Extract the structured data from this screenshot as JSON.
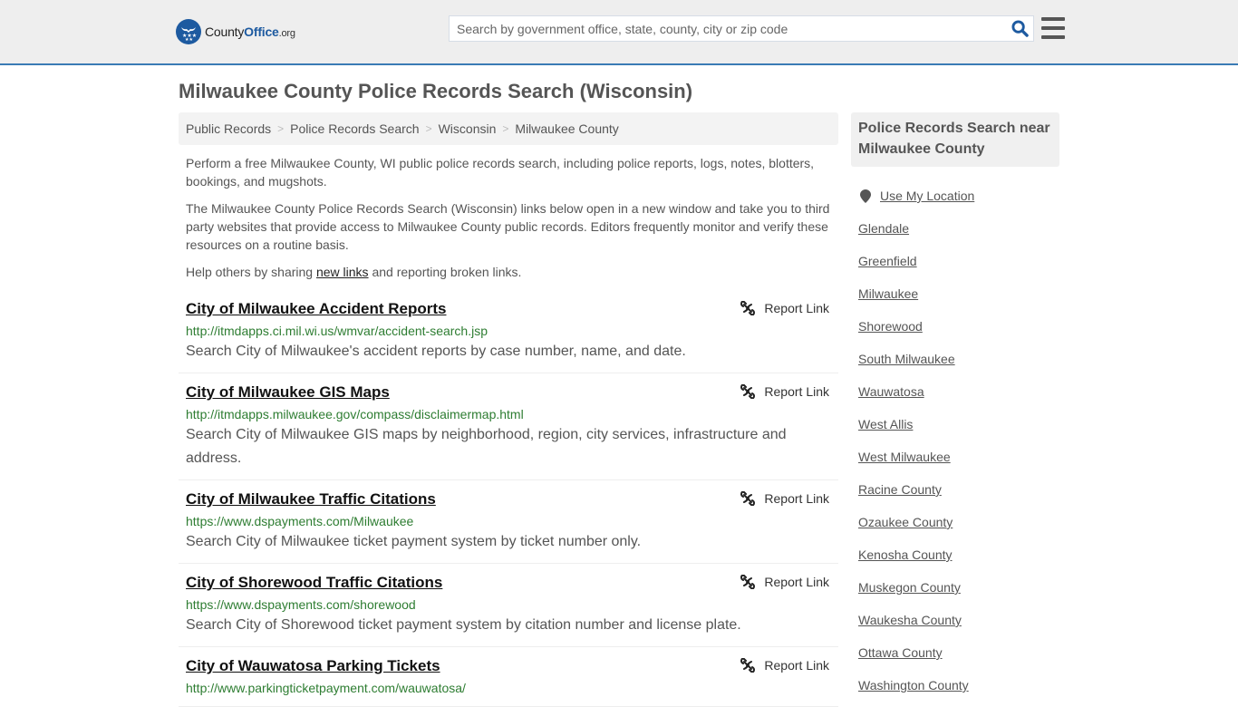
{
  "header": {
    "logo": {
      "brand_prefix": "County",
      "brand_main": "Office",
      "brand_suffix": ".org",
      "icon": "eagle-stars-logo-icon"
    },
    "search": {
      "placeholder": "Search by government office, state, county, city or zip code",
      "value": "",
      "icon": "search-icon"
    },
    "menu_icon": "hamburger-menu-icon"
  },
  "page": {
    "title": "Milwaukee County Police Records Search (Wisconsin)"
  },
  "breadcrumb": [
    {
      "label": "Public Records"
    },
    {
      "label": "Police Records Search"
    },
    {
      "label": "Wisconsin"
    },
    {
      "label": "Milwaukee County"
    }
  ],
  "breadcrumb_separator": ">",
  "intro": {
    "p1": "Perform a free Milwaukee County, WI public police records search, including police reports, logs, notes, blotters, bookings, and mugshots.",
    "p2": "The Milwaukee County Police Records Search (Wisconsin) links below open in a new window and take you to third party websites that provide access to Milwaukee County public records. Editors frequently monitor and verify these resources on a routine basis.",
    "p3_before": "Help others by sharing ",
    "p3_link": "new links",
    "p3_after": " and reporting broken links."
  },
  "results": [
    {
      "title": "City of Milwaukee Accident Reports",
      "url": "http://itmdapps.ci.mil.wi.us/wmvar/accident-search.jsp",
      "description": "Search City of Milwaukee's accident reports by case number, name, and date.",
      "report_label": "Report Link"
    },
    {
      "title": "City of Milwaukee GIS Maps",
      "url": "http://itmdapps.milwaukee.gov/compass/disclaimermap.html",
      "description": "Search City of Milwaukee GIS maps by neighborhood, region, city services, infrastructure and address.",
      "report_label": "Report Link"
    },
    {
      "title": "City of Milwaukee Traffic Citations",
      "url": "https://www.dspayments.com/Milwaukee",
      "description": "Search City of Milwaukee ticket payment system by ticket number only.",
      "report_label": "Report Link"
    },
    {
      "title": "City of Shorewood Traffic Citations",
      "url": "https://www.dspayments.com/shorewood",
      "description": "Search City of Shorewood ticket payment system by citation number and license plate.",
      "report_label": "Report Link"
    },
    {
      "title": "City of Wauwatosa Parking Tickets",
      "url": "http://www.parkingticketpayment.com/wauwatosa/",
      "description": "",
      "report_label": "Report Link"
    }
  ],
  "sidebar": {
    "heading": "Police Records Search near Milwaukee County",
    "use_location": "Use My Location",
    "links": [
      "Glendale",
      "Greenfield",
      "Milwaukee",
      "Shorewood",
      "South Milwaukee",
      "Wauwatosa",
      "West Allis",
      "West Milwaukee",
      "Racine County",
      "Ozaukee County",
      "Kenosha County",
      "Muskegon County",
      "Waukesha County",
      "Ottawa County",
      "Washington County"
    ]
  },
  "colors": {
    "brand_blue": "#1d5aa0",
    "header_border": "#3a7bb5",
    "url_green": "#2e7d32",
    "text_gray": "#555555"
  }
}
